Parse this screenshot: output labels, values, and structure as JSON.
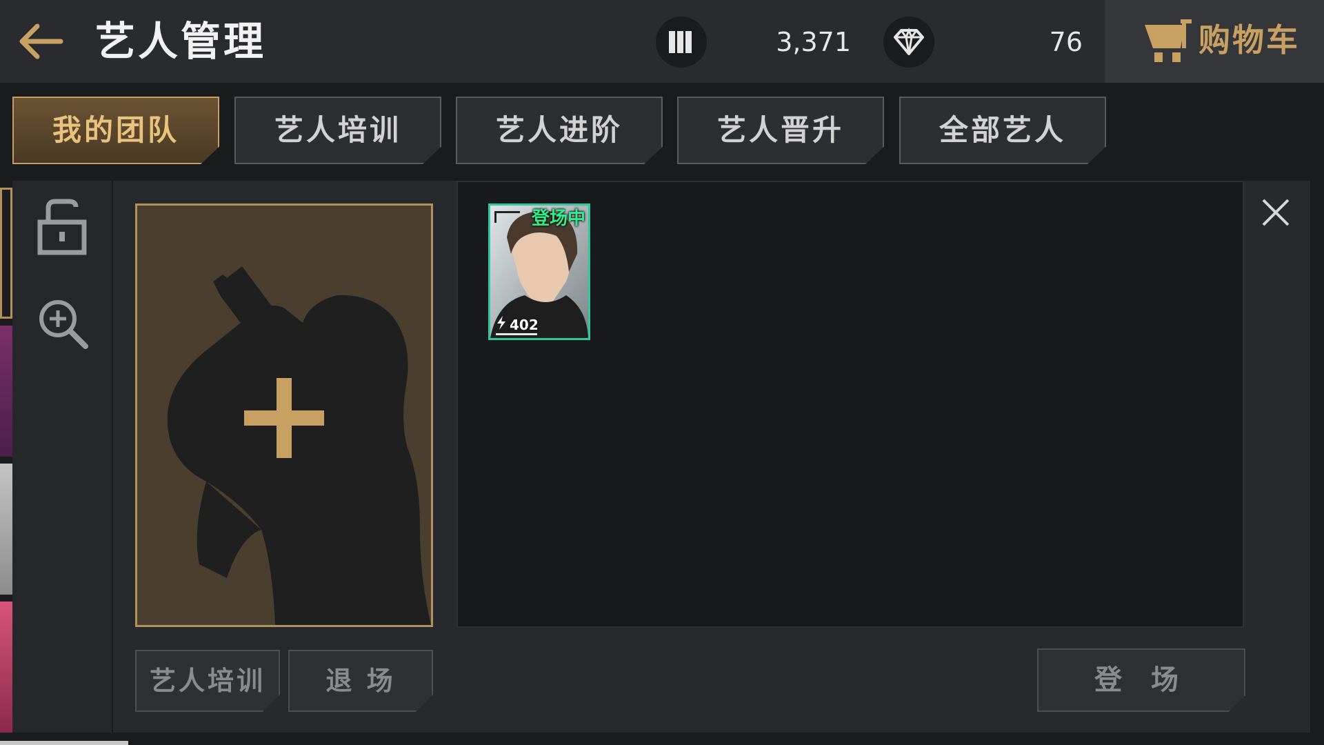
{
  "header": {
    "title": "艺人管理",
    "back_icon": "back-arrow-icon",
    "resources": [
      {
        "icon": "bars-icon",
        "value": "3,371"
      },
      {
        "icon": "diamond-icon",
        "value": "76"
      }
    ],
    "cart_label": "购物车",
    "cart_icon": "cart-icon"
  },
  "tabs": [
    {
      "label": "我的团队",
      "active": true
    },
    {
      "label": "艺人培训",
      "active": false
    },
    {
      "label": "艺人进阶",
      "active": false
    },
    {
      "label": "艺人晋升",
      "active": false
    },
    {
      "label": "全部艺人",
      "active": false
    }
  ],
  "toolbar": {
    "lock_icon": "unlock-icon",
    "zoom_icon": "zoom-in-icon"
  },
  "slot": {
    "icon": "add-artist-icon"
  },
  "slot_buttons": {
    "train": "艺人培训",
    "leave": "退 场"
  },
  "roster": {
    "cards": [
      {
        "status": "登场中",
        "power": "402"
      }
    ]
  },
  "deploy_button": "登 场",
  "colors": {
    "accent": "#c8a062",
    "card_border": "#2ec9a0",
    "status_text": "#2df08c"
  }
}
